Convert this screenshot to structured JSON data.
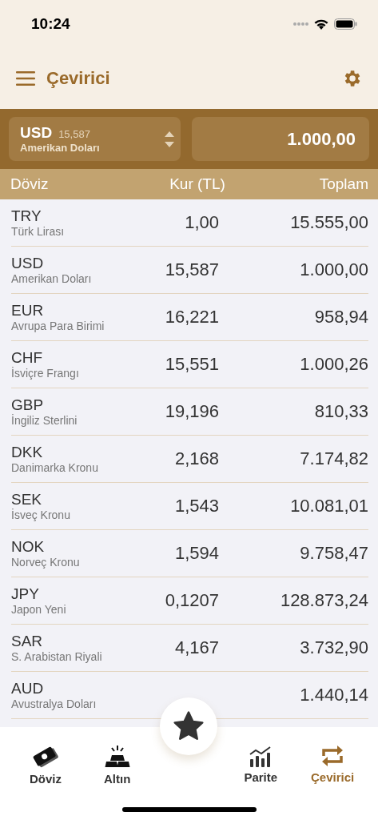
{
  "status_bar": {
    "time": "10:24"
  },
  "header": {
    "title": "Çevirici"
  },
  "converter": {
    "code": "USD",
    "rate": "15,587",
    "name": "Amerikan Doları",
    "amount": "1.000,00"
  },
  "table": {
    "columns": [
      "Döviz",
      "Kur (TL)",
      "Toplam"
    ],
    "rows": [
      {
        "code": "TRY",
        "name": "Türk Lirası",
        "rate": "1,00",
        "total": "15.555,00"
      },
      {
        "code": "USD",
        "name": "Amerikan Doları",
        "rate": "15,587",
        "total": "1.000,00"
      },
      {
        "code": "EUR",
        "name": "Avrupa Para Birimi",
        "rate": "16,221",
        "total": "958,94"
      },
      {
        "code": "CHF",
        "name": "İsviçre Frangı",
        "rate": "15,551",
        "total": "1.000,26"
      },
      {
        "code": "GBP",
        "name": "İngiliz Sterlini",
        "rate": "19,196",
        "total": "810,33"
      },
      {
        "code": "DKK",
        "name": "Danimarka Kronu",
        "rate": "2,168",
        "total": "7.174,82"
      },
      {
        "code": "SEK",
        "name": "İsveç Kronu",
        "rate": "1,543",
        "total": "10.081,01"
      },
      {
        "code": "NOK",
        "name": "Norveç Kronu",
        "rate": "1,594",
        "total": "9.758,47"
      },
      {
        "code": "JPY",
        "name": "Japon Yeni",
        "rate": "0,1207",
        "total": "128.873,24"
      },
      {
        "code": "SAR",
        "name": "S. Arabistan Riyali",
        "rate": "4,167",
        "total": "3.732,90"
      },
      {
        "code": "AUD",
        "name": "Avustralya Doları",
        "total": "1.440,14"
      }
    ]
  },
  "tab_bar": {
    "items": [
      {
        "kind": "money",
        "label": "Döviz",
        "selected": false
      },
      {
        "kind": "gold",
        "label": "Altın",
        "selected": false
      },
      {
        "kind": "favorites",
        "selected": false
      },
      {
        "kind": "chart",
        "label": "Parite",
        "selected": false
      },
      {
        "kind": "swap",
        "label": "Çevirici",
        "selected": true
      }
    ]
  }
}
